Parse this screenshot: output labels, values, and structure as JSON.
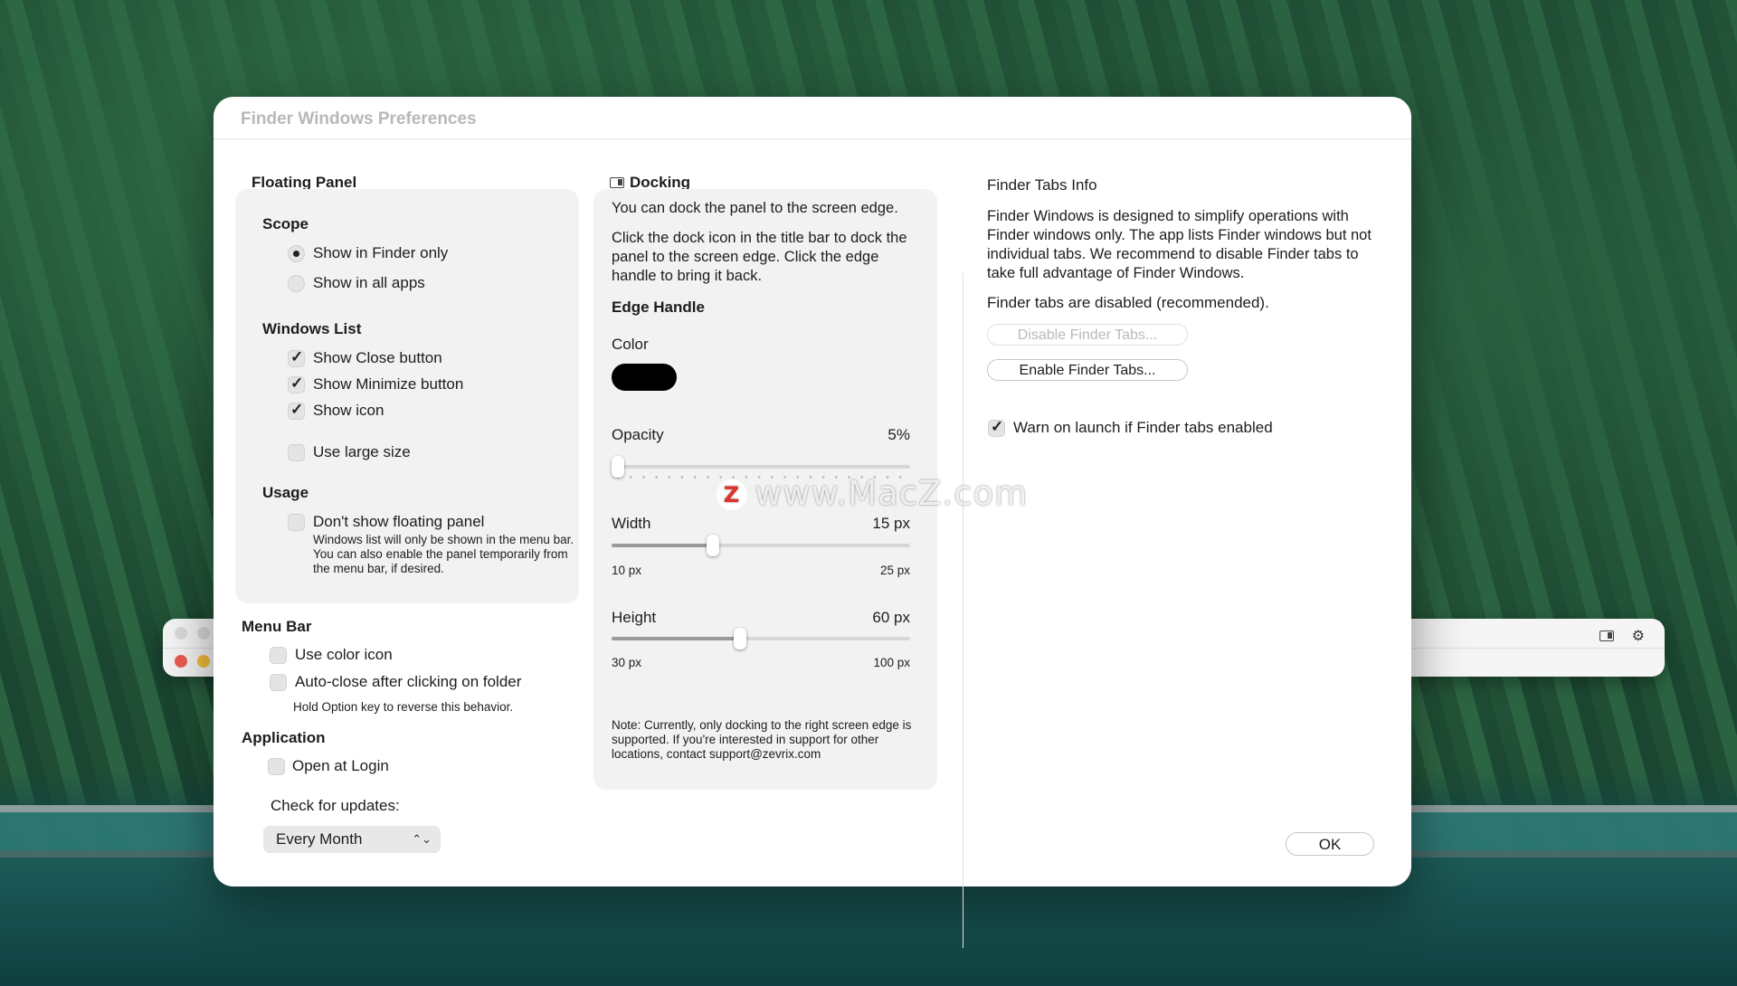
{
  "dialog": {
    "title": "Finder Windows Preferences",
    "ok_label": "OK"
  },
  "floating_panel": {
    "heading": "Floating Panel",
    "scope": {
      "title": "Scope",
      "options": [
        "Show in Finder only",
        "Show in all apps"
      ],
      "selected": "Show in Finder only"
    },
    "windows_list": {
      "title": "Windows List",
      "show_close": {
        "label": "Show Close button",
        "checked": true
      },
      "show_minimize": {
        "label": "Show Minimize button",
        "checked": true
      },
      "show_icon": {
        "label": "Show icon",
        "checked": true
      },
      "large_size": {
        "label": "Use large size",
        "checked": false
      }
    },
    "usage": {
      "title": "Usage",
      "dont_show": {
        "label": "Don't show floating panel",
        "checked": false
      },
      "note": "Windows list will only be shown in the menu bar. You can also enable the panel temporarily from the menu bar, if desired."
    }
  },
  "menu_bar": {
    "heading": "Menu Bar",
    "color_icon": {
      "label": "Use color icon",
      "checked": false
    },
    "auto_close": {
      "label": "Auto-close after clicking on folder",
      "checked": false
    },
    "hint": "Hold Option key to reverse this behavior."
  },
  "application": {
    "heading": "Application",
    "open_at_login": {
      "label": "Open at Login",
      "checked": false
    },
    "updates_label": "Check for updates:",
    "updates_value": "Every Month"
  },
  "docking": {
    "heading": "Docking",
    "intro": "You can dock the panel to the screen edge.",
    "instructions": "Click the dock icon in the title bar to dock the panel to the screen edge. Click the edge handle to bring it back.",
    "edge_handle": {
      "title": "Edge Handle",
      "color_label": "Color",
      "color_value": "#000000",
      "opacity": {
        "label": "Opacity",
        "value_text": "5%",
        "fraction": 0.0
      },
      "width": {
        "label": "Width",
        "value_text": "15 px",
        "min_text": "10 px",
        "max_text": "25 px",
        "value": 15,
        "min": 10,
        "max": 25
      },
      "height": {
        "label": "Height",
        "value_text": "60 px",
        "min_text": "30 px",
        "max_text": "100 px",
        "value": 60,
        "min": 30,
        "max": 100
      }
    },
    "note": "Note: Currently, only docking to the right screen edge is supported. If you're interested in support for other locations, contact support@zevrix.com"
  },
  "finder_tabs": {
    "heading": "Finder Tabs Info",
    "description": "Finder Windows is designed to simplify operations with Finder windows only. The app lists Finder windows but not individual tabs. We recommend to disable Finder tabs to take full advantage of Finder Windows.",
    "status": "Finder tabs are disabled (recommended).",
    "disable_label": "Disable Finder Tabs...",
    "enable_label": "Enable Finder Tabs...",
    "warn": {
      "label": "Warn on launch if Finder tabs enabled",
      "checked": true
    }
  },
  "watermark": {
    "logo": "Z",
    "text": "www.MacZ.com"
  },
  "colors": {
    "window_bg": "#ffffff",
    "group_bg": "#f2f2f2",
    "close_dot": "#ec5b51",
    "min_dot": "#f5be3c"
  }
}
